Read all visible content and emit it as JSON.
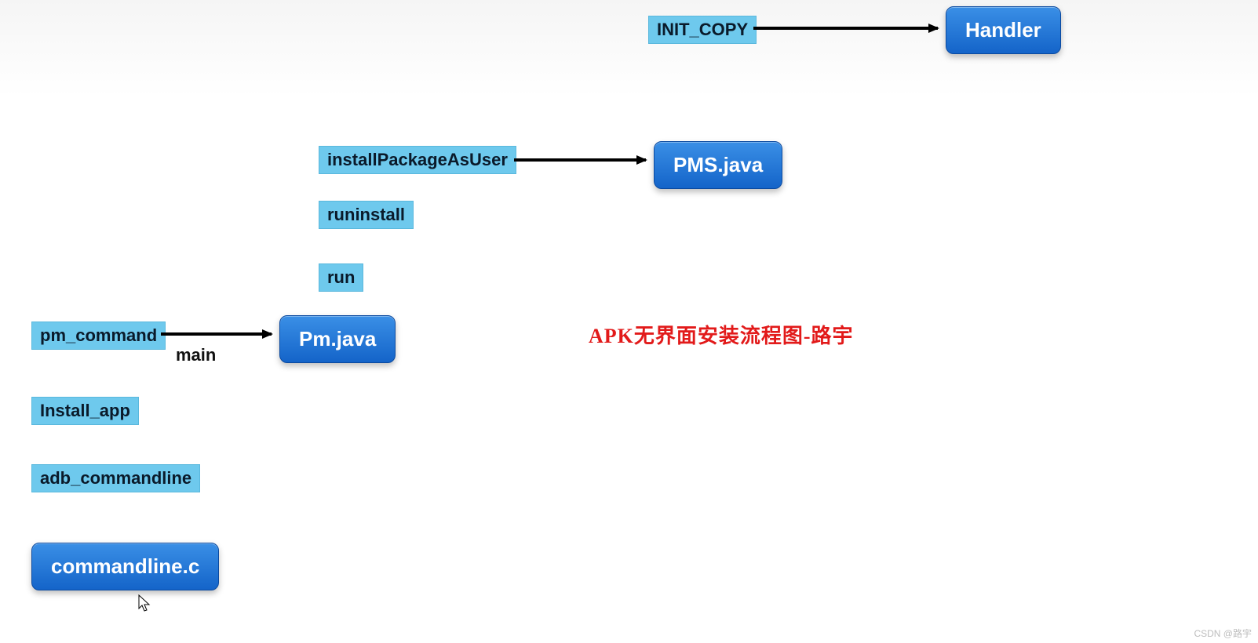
{
  "nodes": {
    "init_copy": "INIT_COPY",
    "handler": "Handler",
    "install_pkg_as_user": "installPackageAsUser",
    "pms_java": "PMS.java",
    "runinstall": "runinstall",
    "run": "run",
    "pm_command": "pm_command",
    "pm_java": "Pm.java",
    "install_app": "Install_app",
    "adb_commandline": "adb_commandline",
    "commandline_c": "commandline.c"
  },
  "edges": {
    "main_label": "main"
  },
  "caption": "APK无界面安装流程图-路宇",
  "watermark": "CSDN @路宇"
}
